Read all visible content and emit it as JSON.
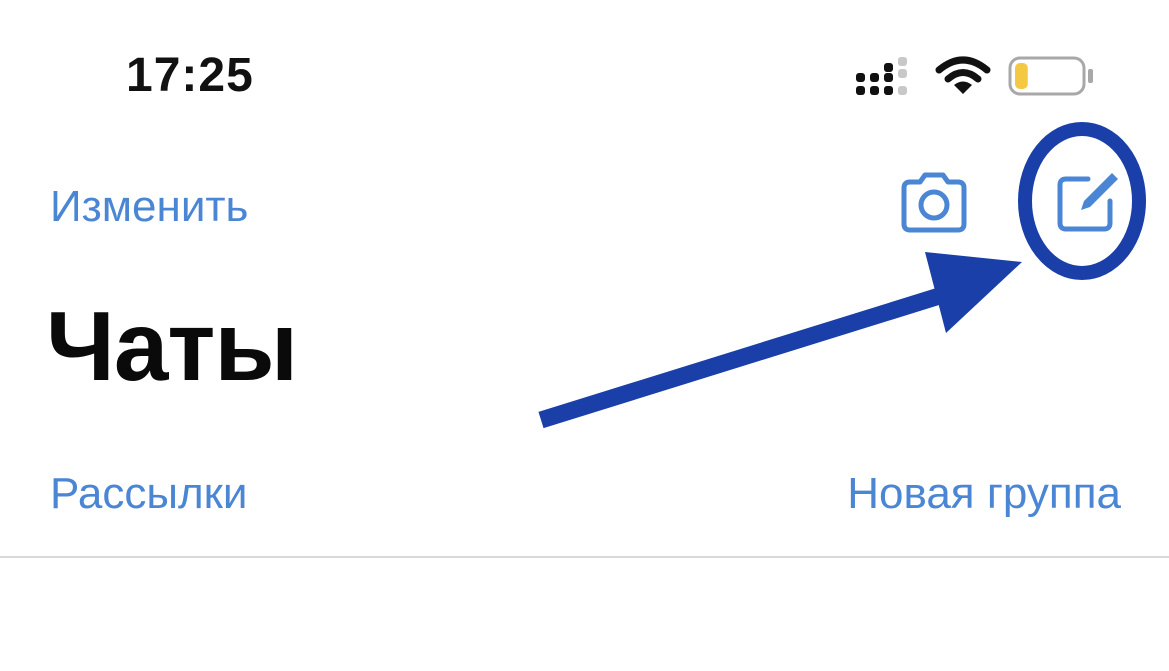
{
  "status_bar": {
    "time": "17:25",
    "signal_icon": "cellular-signal-icon",
    "wifi_icon": "wifi-icon",
    "battery_icon": "battery-low-icon",
    "battery_level": 0.2,
    "battery_fill_color": "#f5c842"
  },
  "nav": {
    "edit_label": "Изменить",
    "camera_icon": "camera-icon",
    "compose_icon": "compose-icon"
  },
  "header": {
    "title": "Чаты"
  },
  "actions": {
    "broadcast_label": "Рассылки",
    "new_group_label": "Новая группа"
  },
  "colors": {
    "accent": "#4a86d4",
    "annotation": "#1a3fa8"
  }
}
